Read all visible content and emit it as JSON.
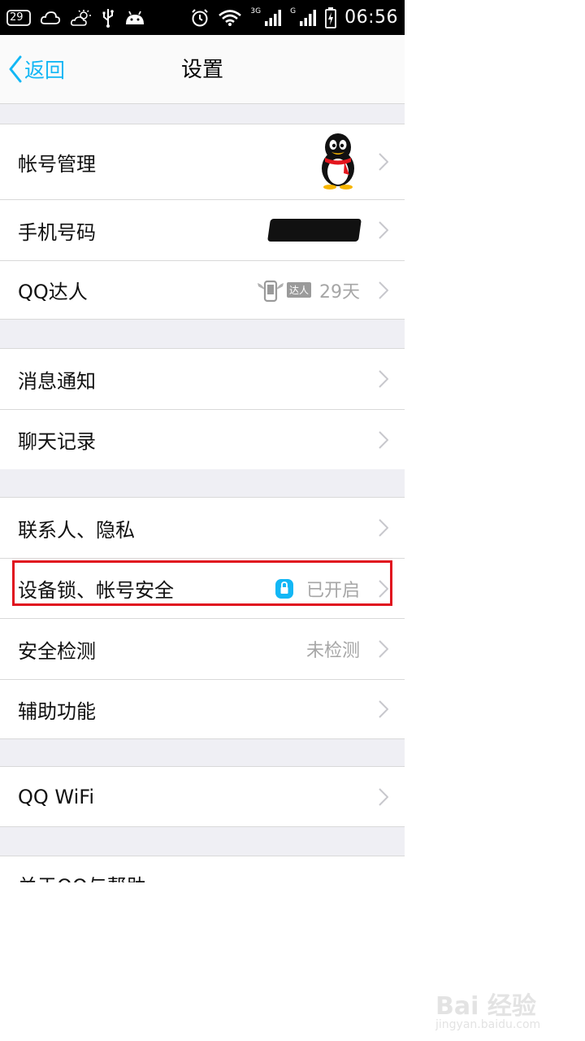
{
  "status_bar": {
    "temperature": "29",
    "network_3g": "3G",
    "network_g": "G",
    "time": "06:56"
  },
  "nav": {
    "back_label": "返回",
    "title": "设置"
  },
  "groups": {
    "g1": {
      "account_label": "帐号管理",
      "phone_label": "手机号码",
      "qqdaren_label": "QQ达人",
      "qqdaren_badge": "达人",
      "qqdaren_value": "29天"
    },
    "g2": {
      "notify_label": "消息通知",
      "chat_label": "聊天记录"
    },
    "g3": {
      "contacts_label": "联系人、隐私",
      "devicelock_label": "设备锁、帐号安全",
      "devicelock_value": "已开启",
      "security_label": "安全检测",
      "security_value": "未检测",
      "accessibility_label": "辅助功能"
    },
    "g4": {
      "wifi_label": "QQ WiFi"
    },
    "g5": {
      "about_label": "关于QQ与帮助"
    }
  },
  "watermark": {
    "main": "Bai 经验",
    "sub": "jingyan.baidu.com"
  },
  "colors": {
    "accent": "#12b7f5",
    "highlight_border": "#e0101e",
    "group_bg": "#efeff4",
    "row_bg": "#ffffff",
    "secondary_text": "#a6a6a6"
  }
}
